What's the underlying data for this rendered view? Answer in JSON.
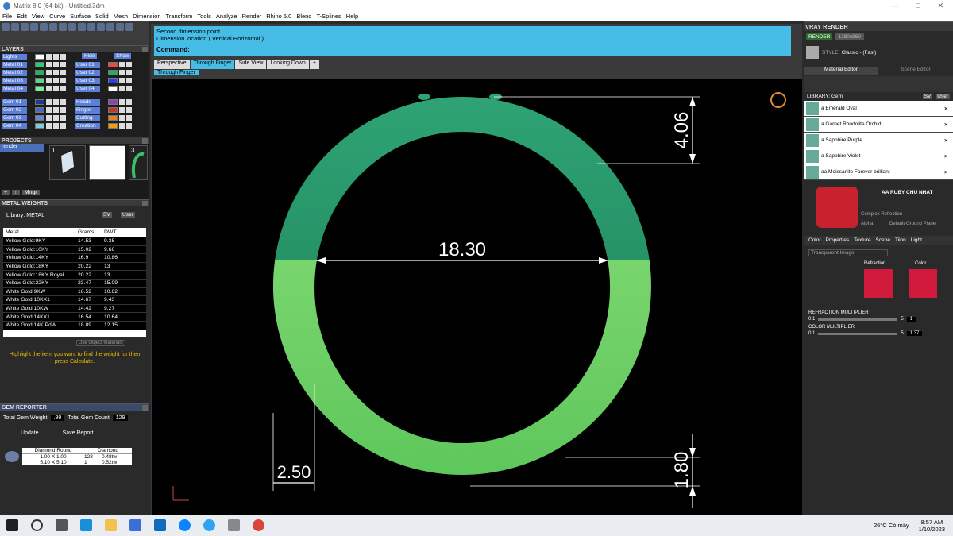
{
  "window": {
    "title": "Matrix 8.0 (64-bit) - Untitled.3dm",
    "minimize": "—",
    "maximize": "□",
    "close": "✕"
  },
  "menu": [
    "File",
    "Edit",
    "View",
    "Curve",
    "Surface",
    "Solid",
    "Mesh",
    "Dimension",
    "Transform",
    "Tools",
    "Analyze",
    "Render",
    "Rhino 5.0",
    "Blend",
    "T-Splines",
    "Help"
  ],
  "layers": {
    "title": "LAYERS",
    "hide": "Hide",
    "show": "Show",
    "left": [
      {
        "name": "Lights",
        "color": "#ffffff"
      },
      {
        "name": "Metal 01",
        "color": "#2ecc71"
      },
      {
        "name": "Metal 02",
        "color": "#27ae60"
      },
      {
        "name": "Metal 03",
        "color": "#58d68d"
      },
      {
        "name": "Metal 04",
        "color": "#7bed9f"
      },
      {
        "name": "Gem 01",
        "color": "#1e3799"
      },
      {
        "name": "Gem 02",
        "color": "#4a69bd"
      },
      {
        "name": "Gem 03",
        "color": "#6a89cc"
      },
      {
        "name": "Gem 04",
        "color": "#82ccdd"
      }
    ],
    "right": [
      {
        "name": "User 01",
        "color": "#e74c3c"
      },
      {
        "name": "User 02",
        "color": "#27ae60"
      },
      {
        "name": "User 03",
        "color": "#2c3ee6"
      },
      {
        "name": "User 04",
        "color": "#ffffff"
      },
      {
        "name": "Heads",
        "color": "#8e44ad"
      },
      {
        "name": "Finger",
        "color": "#c0392b"
      },
      {
        "name": "Cutting",
        "color": "#e67e22"
      },
      {
        "name": "Creation",
        "color": "#f39c12"
      }
    ]
  },
  "projects": {
    "title": "PROJECTS",
    "item": "render",
    "thumb_nums": [
      "1",
      "3"
    ],
    "add": "+",
    "up": "↑",
    "mngr": "Mngr"
  },
  "metal_weights": {
    "title": "METAL WEIGHTS",
    "library_label": "Library: METAL",
    "sv": "SV",
    "user": "User",
    "headers": [
      "Metal",
      "Grams",
      "DWT"
    ],
    "rows": [
      [
        "Yellow Gold:9KY",
        "14.53",
        "9.35"
      ],
      [
        "Yellow Gold:10KY",
        "15.02",
        "9.66"
      ],
      [
        "Yellow Gold:14KY",
        "16.9",
        "10.86"
      ],
      [
        "Yellow Gold:18KY",
        "20.22",
        "13"
      ],
      [
        "Yellow Gold:18KY Royal",
        "20.22",
        "13"
      ],
      [
        "Yellow Gold:22KY",
        "23.47",
        "15.09"
      ],
      [
        "White Gold:9KW",
        "16.52",
        "10.62"
      ],
      [
        "White Gold:10KX1",
        "14.67",
        "9.43"
      ],
      [
        "White Gold:10KW",
        "14.42",
        "9.27"
      ],
      [
        "White Gold:14KX1",
        "16.54",
        "10.64"
      ],
      [
        "White Gold:14K PdW",
        "18.89",
        "12.15"
      ]
    ],
    "use_object": "Use Object Materials",
    "hint": "Highlight the item you want to find the weight for then press Calculate.",
    "calculate": "Calculate"
  },
  "gem_reporter": {
    "title": "GEM REPORTER",
    "total_weight_label": "Total Gem Weight",
    "total_weight": ".99",
    "total_count_label": "Total Gem Count",
    "total_count": "129",
    "update": "Update",
    "save": "Save Report",
    "col1": "Diamond Round",
    "col2": "Diamond",
    "rows": [
      [
        "1.00 X 1.00",
        "128",
        "0.48tw"
      ],
      [
        "5.10 X 5.10",
        "1",
        "0.52tw"
      ]
    ]
  },
  "command": {
    "line1": "Second dimension point",
    "line2": "Dimension location ( Vertical  Horizontal )",
    "prompt": "Command:"
  },
  "tabs": [
    "Perspective",
    "Through Finger",
    "Side View",
    "Looking Down",
    "+"
  ],
  "viewport_label": "Through Finger",
  "dims": {
    "width": "18.30",
    "top": "4.06",
    "bottom": "1.80",
    "side": "2.50"
  },
  "vray": {
    "title": "VRAY RENDER",
    "render": "RENDER",
    "resolution": "1280x960",
    "style_label": "STYLE",
    "style": "Classic - (Fast)",
    "material_editor": "Material Editor",
    "scene_editor": "Scene Editor",
    "library": "LIBRARY: Gem",
    "sv": "SV",
    "user": "User",
    "materials": [
      "a Emerald Oval",
      "a Garnet Rhodolite Orchid",
      "a Sapphire Purple",
      "a Sapphire Violet",
      "aa Moissanite Forever brilliant"
    ],
    "selected_material": "AA RUBY CHU NHAT",
    "complex_reflection": "Complex Reflection",
    "alpha": "Alpha",
    "ground": "Default-Ground Plane",
    "subtabs": [
      "Color",
      "Properties",
      "Texture",
      "Scene",
      "Tiion",
      "Light"
    ],
    "transparent": "Transparent Image",
    "refraction": "Refraction",
    "color": "Color",
    "refraction_mult": "REFRACTION MULTIPLIER",
    "color_mult": "COLOR MULTIPLIER",
    "min": "0.1",
    "max": "5",
    "refraction_val": "1",
    "color_val": "1.37"
  },
  "taskbar": {
    "weather": "26°C Có mây",
    "time": "8:57 AM",
    "date": "1/10/2023"
  }
}
